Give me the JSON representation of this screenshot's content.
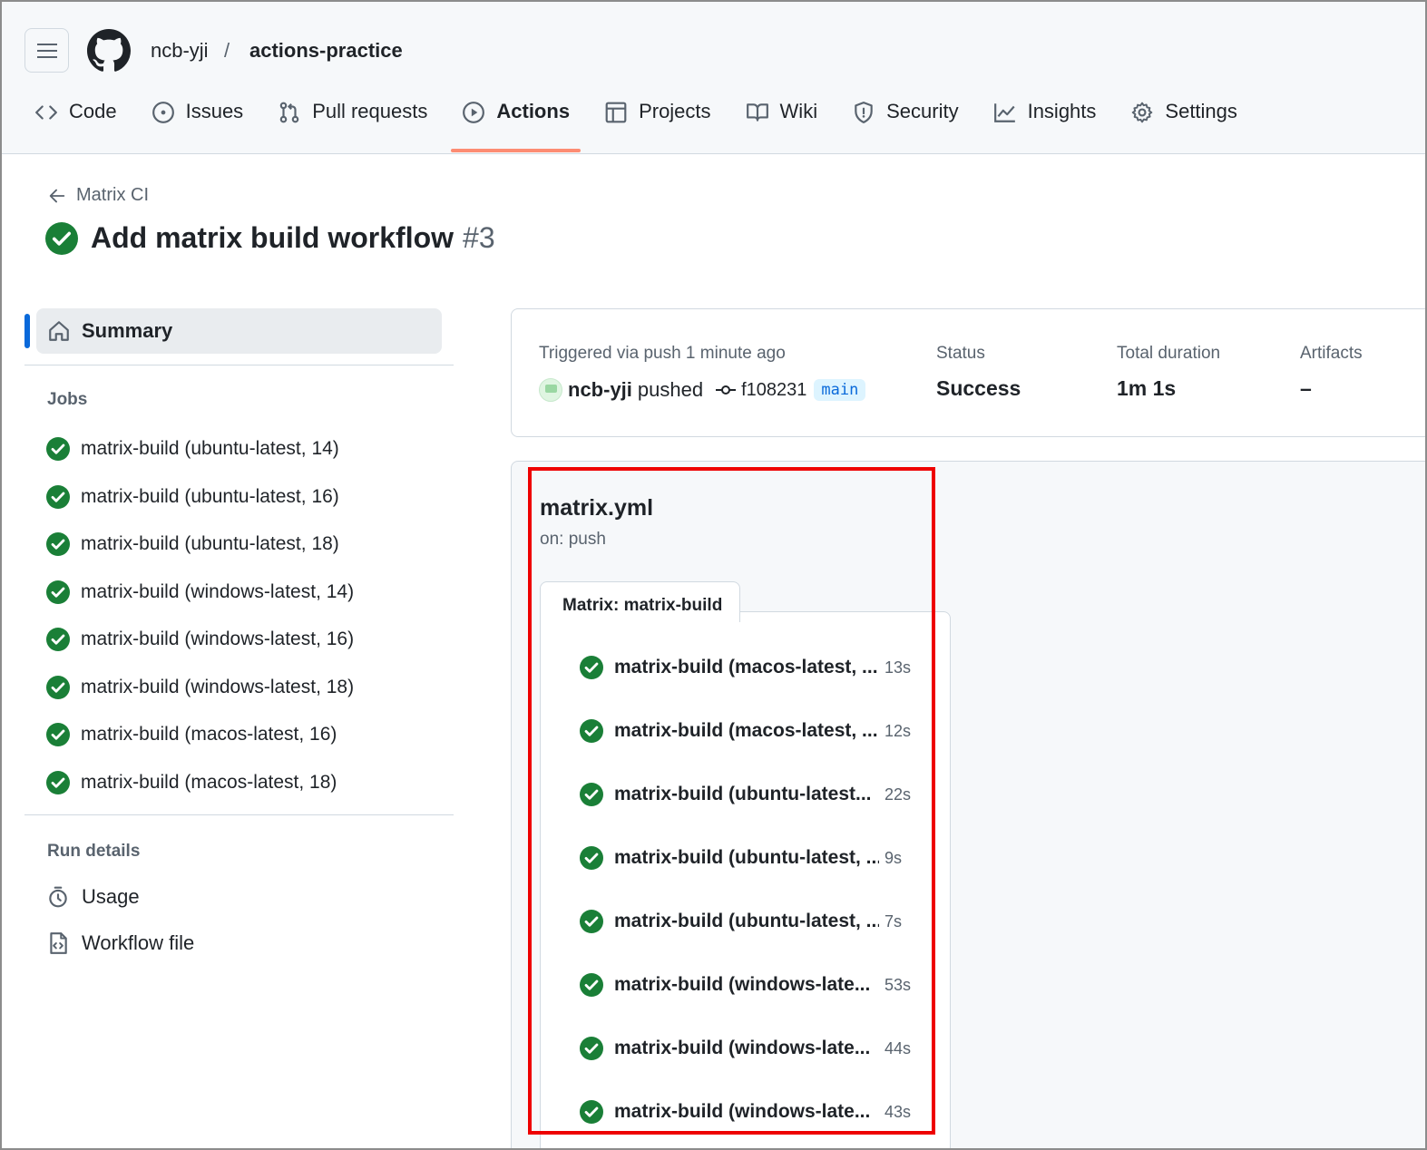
{
  "header": {
    "owner": "ncb-yji",
    "separator": "/",
    "repo": "actions-practice",
    "tabs": [
      {
        "label": "Code",
        "icon": "code-icon"
      },
      {
        "label": "Issues",
        "icon": "issue-icon"
      },
      {
        "label": "Pull requests",
        "icon": "pull-request-icon"
      },
      {
        "label": "Actions",
        "icon": "play-icon",
        "active": true
      },
      {
        "label": "Projects",
        "icon": "table-icon"
      },
      {
        "label": "Wiki",
        "icon": "book-icon"
      },
      {
        "label": "Security",
        "icon": "shield-icon"
      },
      {
        "label": "Insights",
        "icon": "graph-icon"
      },
      {
        "label": "Settings",
        "icon": "gear-icon"
      }
    ]
  },
  "run": {
    "back_label": "Matrix CI",
    "title": "Add matrix build workflow",
    "number": "#3"
  },
  "sidebar": {
    "summary_label": "Summary",
    "jobs_heading": "Jobs",
    "jobs": [
      "matrix-build (ubuntu-latest, 14)",
      "matrix-build (ubuntu-latest, 16)",
      "matrix-build (ubuntu-latest, 18)",
      "matrix-build (windows-latest, 14)",
      "matrix-build (windows-latest, 16)",
      "matrix-build (windows-latest, 18)",
      "matrix-build (macos-latest, 16)",
      "matrix-build (macos-latest, 18)"
    ],
    "run_details_heading": "Run details",
    "usage_label": "Usage",
    "workflow_file_label": "Workflow file"
  },
  "summary": {
    "trigger_label": "Triggered via push 1 minute ago",
    "pusher": "ncb-yji",
    "pushed_text": "pushed",
    "commit": "f108231",
    "branch": "main",
    "status_label": "Status",
    "status_value": "Success",
    "duration_label": "Total duration",
    "duration_value": "1m 1s",
    "artifacts_label": "Artifacts",
    "artifacts_value": "–"
  },
  "graph": {
    "workflow_file": "matrix.yml",
    "trigger": "on: push",
    "matrix_label": "Matrix: matrix-build",
    "jobs": [
      {
        "label": "matrix-build (macos-latest, ...",
        "duration": "13s"
      },
      {
        "label": "matrix-build (macos-latest, ...",
        "duration": "12s"
      },
      {
        "label": "matrix-build (ubuntu-latest...",
        "duration": "22s"
      },
      {
        "label": "matrix-build (ubuntu-latest, ...",
        "duration": "9s"
      },
      {
        "label": "matrix-build (ubuntu-latest, ...",
        "duration": "7s"
      },
      {
        "label": "matrix-build (windows-late...",
        "duration": "53s"
      },
      {
        "label": "matrix-build (windows-late...",
        "duration": "44s"
      },
      {
        "label": "matrix-build (windows-late...",
        "duration": "43s"
      }
    ]
  },
  "colors": {
    "success": "#1a7f37",
    "accent": "#0969da",
    "active_tab_underline": "#fd8c73",
    "highlight": "#ee0000"
  }
}
